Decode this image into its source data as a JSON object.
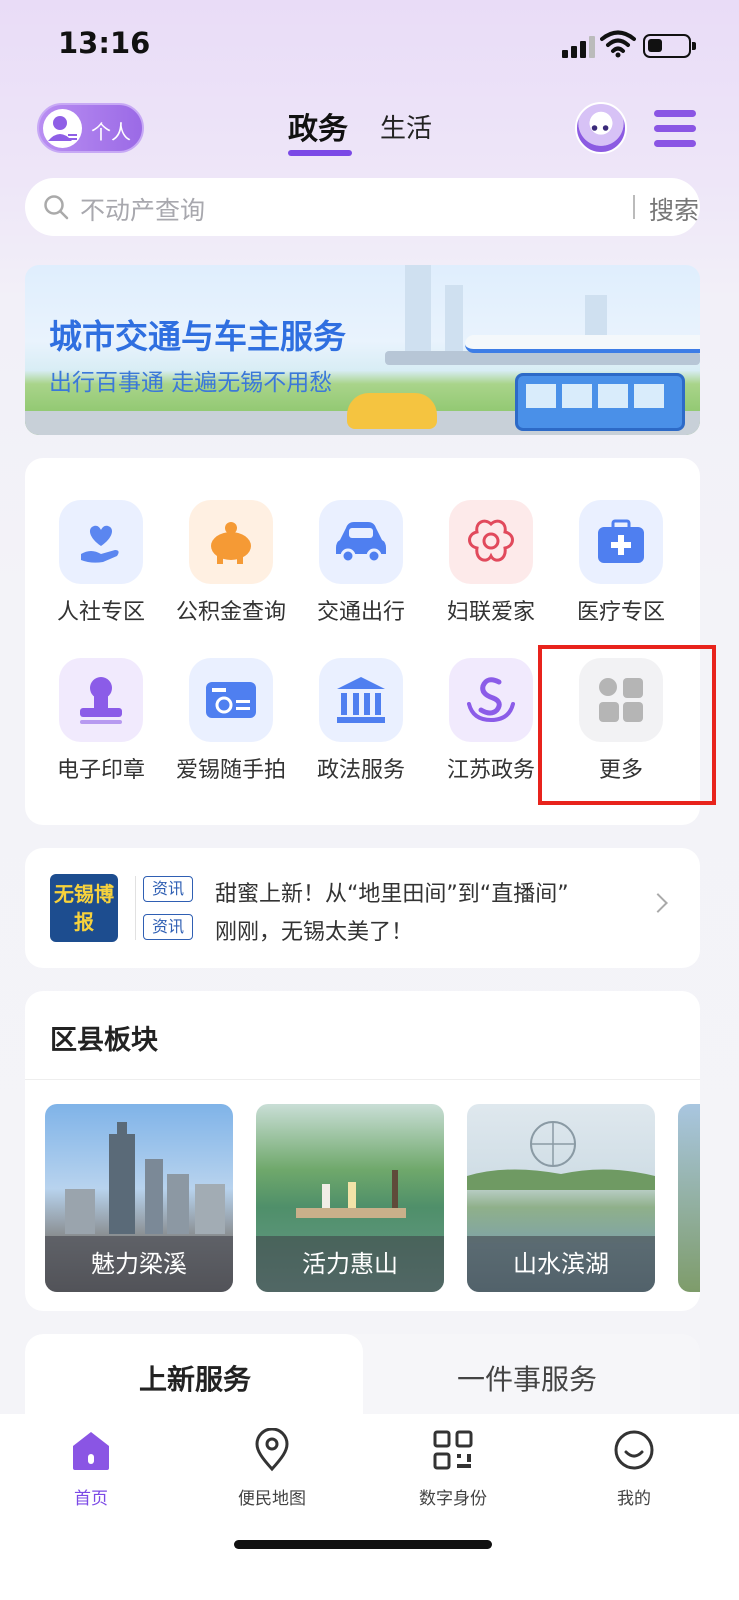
{
  "status_bar": {
    "time": "13:16"
  },
  "header": {
    "persona_label": "个人",
    "tabs": [
      {
        "label": "政务",
        "active": true
      },
      {
        "label": "生活",
        "active": false
      }
    ]
  },
  "search": {
    "placeholder": "不动产查询",
    "button_label": "搜索"
  },
  "banner": {
    "title": "城市交通与车主服务",
    "subtitle": "出行百事通 走遍无锡不用愁"
  },
  "services": [
    {
      "label": "人社专区",
      "icon": "hand-heart-icon",
      "color": "#5b86f0"
    },
    {
      "label": "公积金查询",
      "icon": "piggy-bank-icon",
      "color": "#f59a35"
    },
    {
      "label": "交通出行",
      "icon": "car-icon",
      "color": "#4f7ff0"
    },
    {
      "label": "妇联爱家",
      "icon": "womens-federation-logo-icon",
      "color": "#e14a5c"
    },
    {
      "label": "医疗专区",
      "icon": "medical-kit-icon",
      "color": "#4f7ff0"
    },
    {
      "label": "电子印章",
      "icon": "stamp-icon",
      "color": "#8b5ce8"
    },
    {
      "label": "爱锡随手拍",
      "icon": "camera-icon",
      "color": "#4f7ff0"
    },
    {
      "label": "政法服务",
      "icon": "courthouse-icon",
      "color": "#4f7ff0"
    },
    {
      "label": "江苏政务",
      "icon": "jiangsu-gov-logo-icon",
      "color": "#8b5ce8"
    },
    {
      "label": "更多",
      "icon": "grid-more-icon",
      "color": "#b5b5b5"
    }
  ],
  "news": {
    "source_logo": "无锡博报",
    "items": [
      {
        "tag": "资讯",
        "text": "甜蜜上新！从“地里田间”到“直播间”"
      },
      {
        "tag": "资讯",
        "text": "刚刚，无锡太美了！"
      }
    ]
  },
  "districts": {
    "title": "区县板块",
    "items": [
      {
        "label": "魅力梁溪"
      },
      {
        "label": "活力惠山"
      },
      {
        "label": "山水滨湖"
      }
    ]
  },
  "service_tabs": [
    {
      "label": "上新服务",
      "active": true
    },
    {
      "label": "一件事服务",
      "active": false
    }
  ],
  "bottom_nav": [
    {
      "label": "首页",
      "icon": "home-icon",
      "active": true
    },
    {
      "label": "便民地图",
      "icon": "map-pin-icon",
      "active": false
    },
    {
      "label": "数字身份",
      "icon": "qr-code-icon",
      "active": false
    },
    {
      "label": "我的",
      "icon": "smiley-icon",
      "active": false
    }
  ],
  "colors": {
    "accent": "#7b49e6",
    "highlight": "#e8231c",
    "banner_title": "#2f6fe0"
  }
}
